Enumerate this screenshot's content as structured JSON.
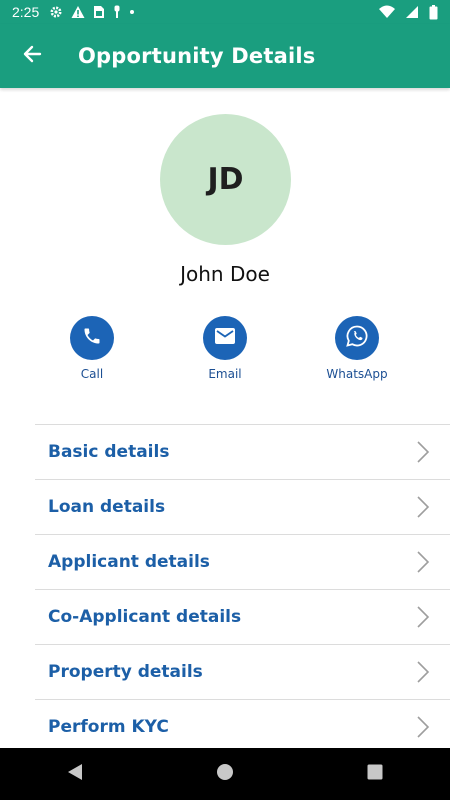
{
  "status_bar": {
    "time": "2:25",
    "icons": [
      "gear-icon",
      "warning-icon",
      "sim-icon",
      "dot-icon"
    ],
    "right_icons": [
      "wifi-icon",
      "signal-icon",
      "battery-icon"
    ]
  },
  "app_bar": {
    "title": "Opportunity Details",
    "back_icon": "arrow-left-icon"
  },
  "profile": {
    "initials": "JD",
    "name": "John Doe",
    "avatar_color": "#c9e6cc"
  },
  "actions": [
    {
      "label": "Call",
      "icon": "phone-icon"
    },
    {
      "label": "Email",
      "icon": "mail-icon"
    },
    {
      "label": "WhatsApp",
      "icon": "whatsapp-icon"
    }
  ],
  "details_list": [
    {
      "label": "Basic details"
    },
    {
      "label": "Loan details"
    },
    {
      "label": "Applicant details"
    },
    {
      "label": "Co-Applicant details"
    },
    {
      "label": "Property details"
    },
    {
      "label": "Perform KYC"
    }
  ],
  "colors": {
    "primary": "#1a9e7f",
    "accent": "#1c64b6",
    "list_text": "#1c5fa7"
  },
  "nav_bar": {
    "buttons": [
      "back-triangle-icon",
      "home-circle-icon",
      "recents-square-icon"
    ]
  }
}
